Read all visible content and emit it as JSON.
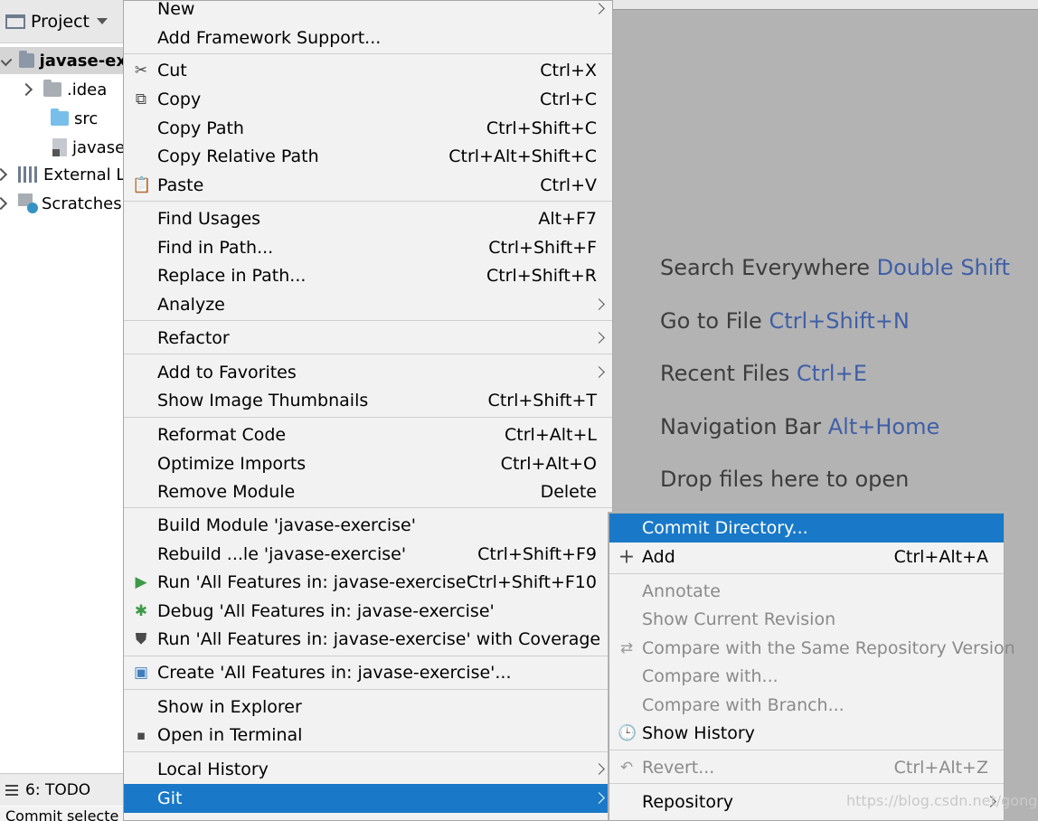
{
  "project": {
    "title": "Project",
    "tree": [
      "javase-ex",
      ".idea",
      "src",
      "javase",
      "External L",
      "Scratches"
    ]
  },
  "bottom": {
    "tool": "6: TODO",
    "status": "Commit selecte"
  },
  "hints": [
    {
      "text": "Search Everywhere",
      "key": "Double Shift"
    },
    {
      "text": "Go to File",
      "key": "Ctrl+Shift+N"
    },
    {
      "text": "Recent Files",
      "key": "Ctrl+E"
    },
    {
      "text": "Navigation Bar",
      "key": "Alt+Home"
    },
    {
      "text": "Drop files here to open",
      "key": ""
    }
  ],
  "menu": {
    "new": "New",
    "add_framework": "Add Framework Support...",
    "cut": "Cut",
    "cut_sc": "Ctrl+X",
    "copy": "Copy",
    "copy_sc": "Ctrl+C",
    "copy_path": "Copy Path",
    "copy_path_sc": "Ctrl+Shift+C",
    "copy_rel": "Copy Relative Path",
    "copy_rel_sc": "Ctrl+Alt+Shift+C",
    "paste": "Paste",
    "paste_sc": "Ctrl+V",
    "find_usages": "Find Usages",
    "find_usages_sc": "Alt+F7",
    "find_in_path": "Find in Path...",
    "find_in_path_sc": "Ctrl+Shift+F",
    "replace_in_path": "Replace in Path...",
    "replace_in_path_sc": "Ctrl+Shift+R",
    "analyze": "Analyze",
    "refactor": "Refactor",
    "add_fav": "Add to Favorites",
    "thumbs": "Show Image Thumbnails",
    "thumbs_sc": "Ctrl+Shift+T",
    "reformat": "Reformat Code",
    "reformat_sc": "Ctrl+Alt+L",
    "optimize": "Optimize Imports",
    "optimize_sc": "Ctrl+Alt+O",
    "remove_module": "Remove Module",
    "remove_module_sc": "Delete",
    "build": "Build Module 'javase-exercise'",
    "rebuild": "Rebuild ...le 'javase-exercise'",
    "rebuild_sc": "Ctrl+Shift+F9",
    "run": "Run 'All Features in: javase-exercise'",
    "run_sc": "Ctrl+Shift+F10",
    "debug": "Debug 'All Features in: javase-exercise'",
    "coverage": "Run 'All Features in: javase-exercise' with Coverage",
    "create": "Create 'All Features in: javase-exercise'...",
    "explorer": "Show in Explorer",
    "terminal": "Open in Terminal",
    "local_history": "Local History",
    "git": "Git"
  },
  "git_menu": {
    "commit": "Commit Directory...",
    "add": "Add",
    "add_sc": "Ctrl+Alt+A",
    "annotate": "Annotate",
    "current_rev": "Show Current Revision",
    "compare_repo": "Compare with the Same Repository Version",
    "compare_with": "Compare with...",
    "compare_branch": "Compare with Branch...",
    "history": "Show History",
    "revert": "Revert...",
    "revert_sc": "Ctrl+Alt+Z",
    "repository": "Repository"
  },
  "watermark": "https://blog.csdn.net/gongaio"
}
